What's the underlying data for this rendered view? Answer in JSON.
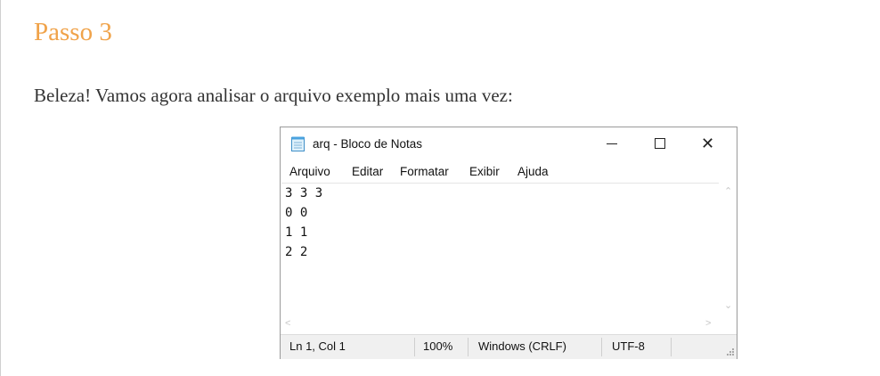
{
  "page": {
    "step_title": "Passo 3",
    "intro_text": "Beleza! Vamos agora analisar o arquivo exemplo mais uma vez:",
    "accent_color": "#f0a34a"
  },
  "notepad": {
    "window_title": "arq - Bloco de Notas",
    "icon": "notepad-icon",
    "controls": {
      "minimize": "—",
      "maximize": "☐",
      "close": "✕"
    },
    "menu": [
      "Arquivo",
      "Editar",
      "Formatar",
      "Exibir",
      "Ajuda"
    ],
    "lines": [
      "3 3 3",
      "0 0",
      "1 1",
      "2 2"
    ],
    "status": {
      "position": "Ln 1, Col 1",
      "zoom": "100%",
      "line_ending": "Windows (CRLF)",
      "encoding": "UTF-8"
    }
  }
}
